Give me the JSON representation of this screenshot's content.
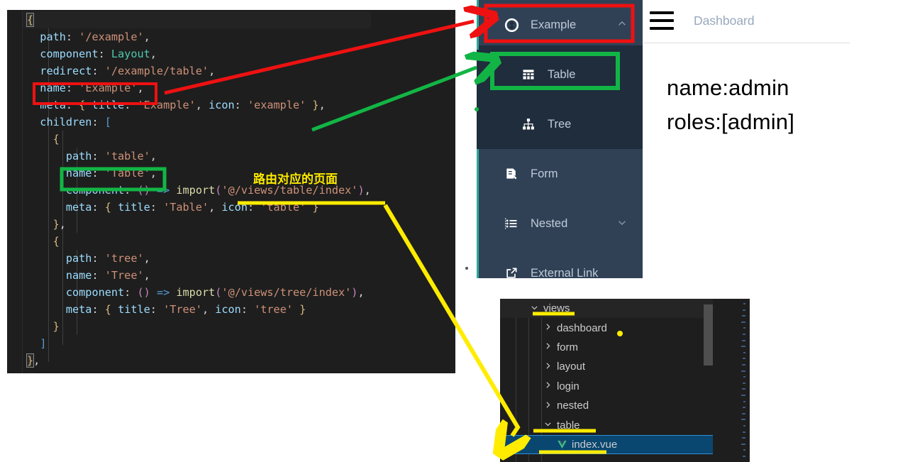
{
  "editor": {
    "name": "route-config-code",
    "language": "javascript",
    "lines": [
      {
        "indent": 0,
        "active": true,
        "text": "{"
      },
      {
        "indent": 1,
        "text": "path: '/example',"
      },
      {
        "indent": 1,
        "text": "component: Layout,"
      },
      {
        "indent": 1,
        "text": "redirect: '/example/table',"
      },
      {
        "indent": 1,
        "text": "name: 'Example',"
      },
      {
        "indent": 1,
        "text": "meta: { title: 'Example', icon: 'example' },"
      },
      {
        "indent": 1,
        "text": "children: ["
      },
      {
        "indent": 2,
        "text": "{"
      },
      {
        "indent": 3,
        "text": "path: 'table',"
      },
      {
        "indent": 3,
        "text": "name: 'Table',"
      },
      {
        "indent": 3,
        "text": "component: () => import('@/views/table/index'),"
      },
      {
        "indent": 3,
        "text": "meta: { title: 'Table', icon: 'table' }"
      },
      {
        "indent": 2,
        "text": "},"
      },
      {
        "indent": 2,
        "text": "{"
      },
      {
        "indent": 3,
        "text": "path: 'tree',"
      },
      {
        "indent": 3,
        "text": "name: 'Tree',"
      },
      {
        "indent": 3,
        "text": "component: () => import('@/views/tree/index'),"
      },
      {
        "indent": 3,
        "text": "meta: { title: 'Tree', icon: 'tree' }"
      },
      {
        "indent": 2,
        "text": "}"
      },
      {
        "indent": 1,
        "text": "]"
      },
      {
        "indent": 0,
        "text": "},"
      }
    ]
  },
  "sidebar": {
    "items": [
      {
        "label": "Example",
        "icon": "example-compass-icon",
        "arrow": "chevron-up-icon",
        "level": "parent",
        "highlight": "red"
      },
      {
        "label": "Table",
        "icon": "table-grid-icon",
        "arrow": "",
        "level": "child",
        "highlight": "green"
      },
      {
        "label": "Tree",
        "icon": "tree-hierarchy-icon",
        "arrow": "",
        "level": "child",
        "highlight": ""
      },
      {
        "label": "Form",
        "icon": "form-document-icon",
        "arrow": "",
        "level": "parent",
        "highlight": ""
      },
      {
        "label": "Nested",
        "icon": "nested-list-icon",
        "arrow": "chevron-down-icon",
        "level": "parent",
        "highlight": ""
      },
      {
        "label": "External Link",
        "icon": "external-link-icon",
        "arrow": "",
        "level": "parent",
        "highlight": ""
      }
    ],
    "colors": {
      "bg": "#304156",
      "sub_bg": "#1f2d3d",
      "text": "#bfcbd9",
      "accent": "#2aa89b"
    }
  },
  "header": {
    "hamburger_icon": "hamburger-menu-icon",
    "breadcrumb": "Dashboard"
  },
  "userinfo": {
    "name_line": "name:admin",
    "roles_line": "roles:[admin]"
  },
  "filetree": {
    "rows": [
      {
        "label": "views",
        "chevron": "chevron-down-icon",
        "depth": 0,
        "type": "folder",
        "selected": false,
        "underline": true
      },
      {
        "label": "dashboard",
        "chevron": "chevron-right-icon",
        "depth": 1,
        "type": "folder",
        "selected": false,
        "underline": false
      },
      {
        "label": "form",
        "chevron": "chevron-right-icon",
        "depth": 1,
        "type": "folder",
        "selected": false,
        "underline": false
      },
      {
        "label": "layout",
        "chevron": "chevron-right-icon",
        "depth": 1,
        "type": "folder",
        "selected": false,
        "underline": false
      },
      {
        "label": "login",
        "chevron": "chevron-right-icon",
        "depth": 1,
        "type": "folder",
        "selected": false,
        "underline": false
      },
      {
        "label": "nested",
        "chevron": "chevron-right-icon",
        "depth": 1,
        "type": "folder",
        "selected": false,
        "underline": false
      },
      {
        "label": "table",
        "chevron": "chevron-down-icon",
        "depth": 1,
        "type": "folder",
        "selected": false,
        "underline": true
      },
      {
        "label": "index.vue",
        "chevron": "",
        "depth": 2,
        "type": "vue-file",
        "selected": true,
        "underline": true
      }
    ],
    "colors": {
      "bg": "#1e1e1e",
      "selected_bg": "#094771",
      "selected_border": "#2f8fd6"
    }
  },
  "annotations": {
    "chinese_note": "路由对应的页面",
    "colors": {
      "red": "#ee1111",
      "green": "#12b545",
      "yellow": "#ffec00"
    },
    "red_arrow": "name:'Example' -> sidebar Example item",
    "green_arrow": "name:'Table' -> sidebar Table item",
    "yellow_arrow": "import('@/views/table/index') -> file tree index.vue"
  }
}
